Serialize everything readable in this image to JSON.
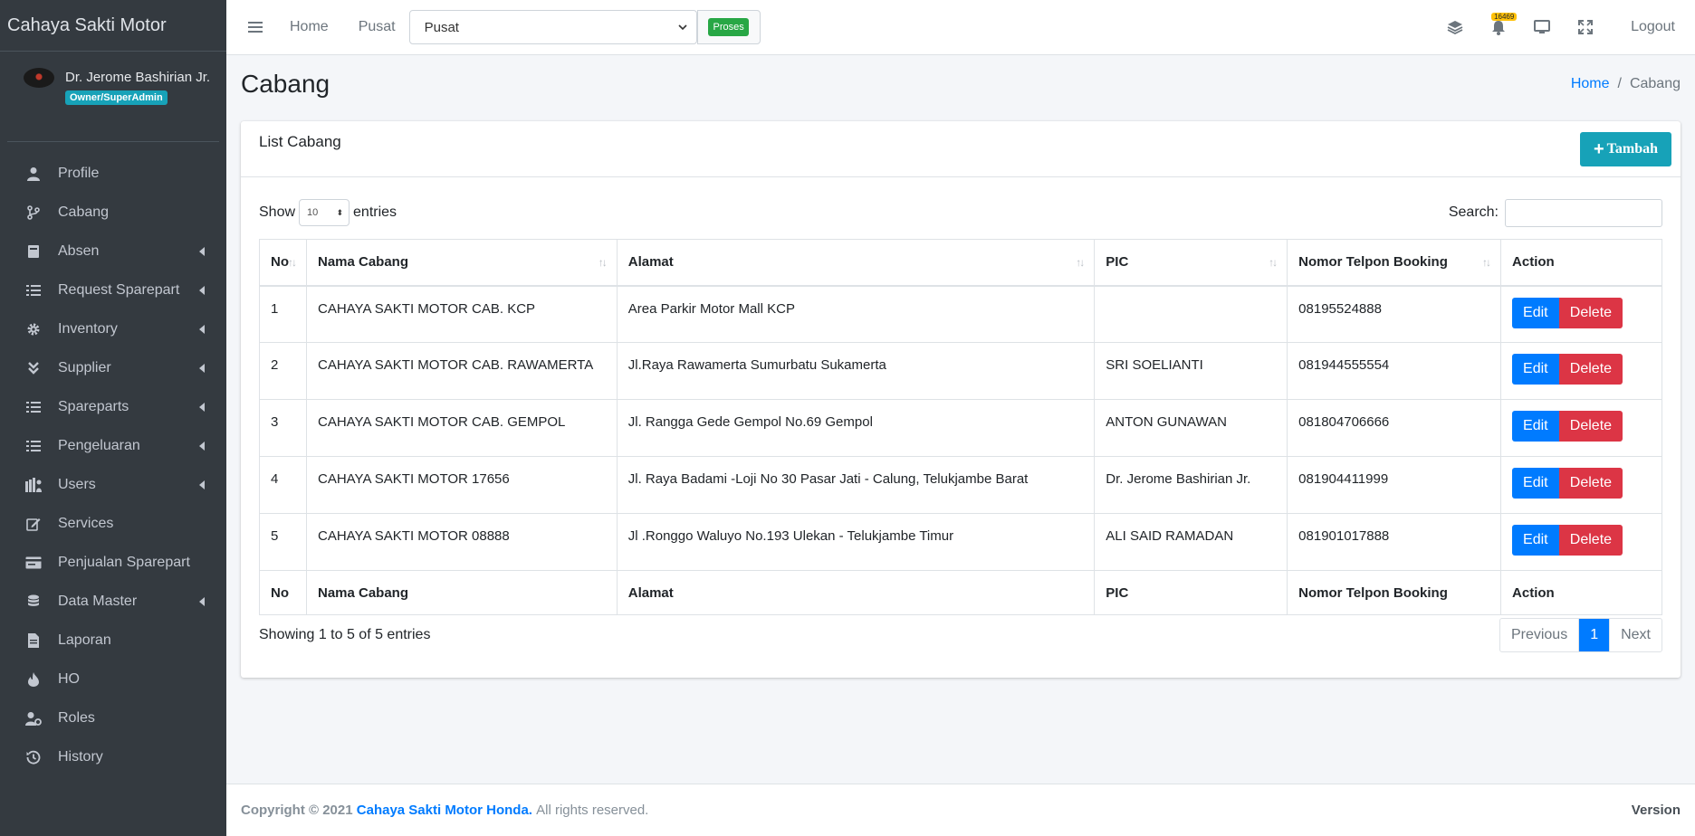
{
  "brand": "Cahaya Sakti Motor",
  "user": {
    "name": "Dr. Jerome Bashirian Jr.",
    "role": "Owner/SuperAdmin"
  },
  "sidebar": {
    "items": [
      {
        "label": "Profile",
        "icon": "user-icon",
        "caret": false
      },
      {
        "label": "Cabang",
        "icon": "code-branch-icon",
        "caret": false
      },
      {
        "label": "Absen",
        "icon": "book-icon",
        "caret": true
      },
      {
        "label": "Request Sparepart",
        "icon": "list-icon",
        "caret": true
      },
      {
        "label": "Inventory",
        "icon": "gear-icon",
        "caret": true
      },
      {
        "label": "Supplier",
        "icon": "double-chevron-down-icon",
        "caret": true
      },
      {
        "label": "Spareparts",
        "icon": "list-icon",
        "caret": true
      },
      {
        "label": "Pengeluaran",
        "icon": "list-icon",
        "caret": true
      },
      {
        "label": "Users",
        "icon": "users-icon",
        "caret": true
      },
      {
        "label": "Services",
        "icon": "edit-icon",
        "caret": false
      },
      {
        "label": "Penjualan Sparepart",
        "icon": "card-icon",
        "caret": false
      },
      {
        "label": "Data Master",
        "icon": "database-icon",
        "caret": true
      },
      {
        "label": "Laporan",
        "icon": "file-icon",
        "caret": false
      },
      {
        "label": "HO",
        "icon": "fire-icon",
        "caret": false
      },
      {
        "label": "Roles",
        "icon": "user-cog-icon",
        "caret": false
      },
      {
        "label": "History",
        "icon": "history-icon",
        "caret": false
      }
    ]
  },
  "topbar": {
    "home": "Home",
    "pusat": "Pusat",
    "select_value": "Pusat",
    "proses": "Proses",
    "notif_count": "16469",
    "logout": "Logout"
  },
  "page": {
    "title": "Cabang",
    "breadcrumb_home": "Home",
    "breadcrumb_sep": "/",
    "breadcrumb_current": "Cabang"
  },
  "card": {
    "title": "List Cabang",
    "add_button": "Tambah",
    "show_label": "Show",
    "entries_label": "entries",
    "length_value": "10",
    "search_label": "Search:",
    "info": "Showing 1 to 5 of 5 entries",
    "prev": "Previous",
    "page": "1",
    "next": "Next"
  },
  "table": {
    "headers": [
      "No",
      "Nama Cabang",
      "Alamat",
      "PIC",
      "Nomor Telpon Booking",
      "Action"
    ],
    "rows": [
      {
        "no": "1",
        "nama": "CAHAYA SAKTI MOTOR CAB. KCP",
        "alamat": "Area Parkir Motor Mall KCP",
        "pic": "",
        "telp": "08195524888"
      },
      {
        "no": "2",
        "nama": "CAHAYA SAKTI MOTOR CAB. RAWAMERTA",
        "alamat": "Jl.Raya Rawamerta Sumurbatu Sukamerta",
        "pic": "SRI SOELIANTI",
        "telp": "081944555554"
      },
      {
        "no": "3",
        "nama": "CAHAYA SAKTI MOTOR CAB. GEMPOL",
        "alamat": "Jl. Rangga Gede Gempol No.69 Gempol",
        "pic": "ANTON GUNAWAN",
        "telp": "081804706666"
      },
      {
        "no": "4",
        "nama": "CAHAYA SAKTI MOTOR 17656",
        "alamat": "Jl. Raya Badami -Loji No 30 Pasar Jati - Calung, Telukjambe Barat",
        "pic": "Dr. Jerome Bashirian Jr.",
        "telp": "081904411999"
      },
      {
        "no": "5",
        "nama": "CAHAYA SAKTI MOTOR 08888",
        "alamat": "Jl .Ronggo Waluyo No.193 Ulekan - Telukjambe Timur",
        "pic": "ALI SAID RAMADAN",
        "telp": "081901017888"
      }
    ],
    "edit_label": "Edit",
    "delete_label": "Delete"
  },
  "footer": {
    "copyright": "Copyright © 2021",
    "company": "Cahaya Sakti Motor Honda.",
    "rights": "All rights reserved.",
    "version": "Version"
  }
}
